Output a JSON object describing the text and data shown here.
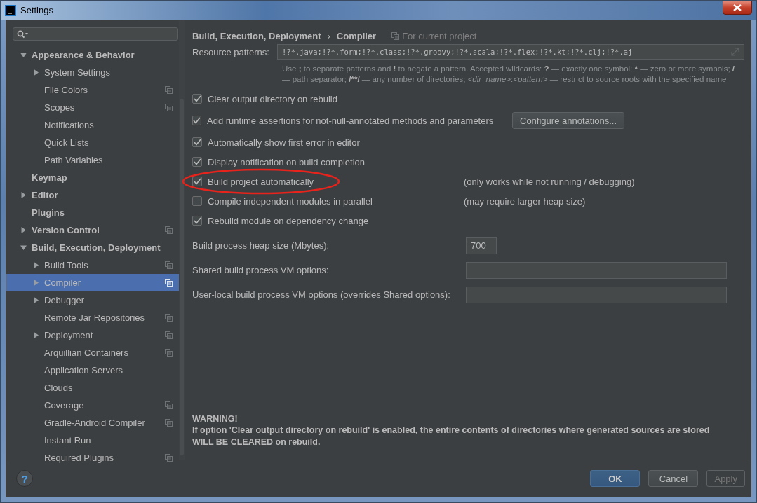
{
  "window": {
    "title": "Settings"
  },
  "sidebar": {
    "items": [
      {
        "label": "Appearance & Behavior",
        "expanded": true,
        "children": [
          {
            "label": "System Settings",
            "expanded": false
          },
          {
            "label": "File Colors",
            "project_level": true
          },
          {
            "label": "Scopes",
            "project_level": true
          },
          {
            "label": "Notifications"
          },
          {
            "label": "Quick Lists"
          },
          {
            "label": "Path Variables"
          }
        ]
      },
      {
        "label": "Keymap"
      },
      {
        "label": "Editor",
        "expanded": false
      },
      {
        "label": "Plugins"
      },
      {
        "label": "Version Control",
        "expanded": false,
        "project_level": true
      },
      {
        "label": "Build, Execution, Deployment",
        "expanded": true,
        "children": [
          {
            "label": "Build Tools",
            "expanded": false,
            "project_level": true
          },
          {
            "label": "Compiler",
            "expanded": false,
            "project_level": true,
            "selected": true
          },
          {
            "label": "Debugger",
            "expanded": false
          },
          {
            "label": "Remote Jar Repositories",
            "project_level": true
          },
          {
            "label": "Deployment",
            "expanded": false,
            "project_level": true
          },
          {
            "label": "Arquillian Containers",
            "project_level": true
          },
          {
            "label": "Application Servers"
          },
          {
            "label": "Clouds"
          },
          {
            "label": "Coverage",
            "project_level": true
          },
          {
            "label": "Gradle-Android Compiler",
            "project_level": true
          },
          {
            "label": "Instant Run"
          },
          {
            "label": "Required Plugins",
            "project_level": true
          }
        ]
      }
    ]
  },
  "breadcrumb": {
    "items": [
      "Build, Execution, Deployment",
      "Compiler"
    ],
    "separator": "›",
    "scope": "For current project"
  },
  "resource_patterns": {
    "label": "Resource patterns:",
    "value": "!?*.java;!?*.form;!?*.class;!?*.groovy;!?*.scala;!?*.flex;!?*.kt;!?*.clj;!?*.aj",
    "help": [
      {
        "text": "Use ",
        "kind": "text"
      },
      {
        "text": ";",
        "kind": "symbol"
      },
      {
        "text": " to separate patterns and ",
        "kind": "text"
      },
      {
        "text": "!",
        "kind": "symbol"
      },
      {
        "text": " to negate a pattern. Accepted wildcards: ",
        "kind": "text"
      },
      {
        "text": "?",
        "kind": "symbol"
      },
      {
        "text": " — exactly one symbol; ",
        "kind": "text"
      },
      {
        "text": "*",
        "kind": "symbol"
      },
      {
        "text": " — zero or more symbols; ",
        "kind": "text"
      },
      {
        "text": "/",
        "kind": "symbol"
      },
      {
        "text": " — path separator; ",
        "kind": "text"
      },
      {
        "text": "/**/",
        "kind": "symbol"
      },
      {
        "text": " — any number of directories; ",
        "kind": "text"
      },
      {
        "text": "<dir_name>",
        "kind": "placeholder"
      },
      {
        "text": ":",
        "kind": "text"
      },
      {
        "text": "<pattern>",
        "kind": "placeholder"
      },
      {
        "text": " — restrict to source roots with the specified name",
        "kind": "text"
      }
    ]
  },
  "options": [
    {
      "label": "Clear output directory on rebuild",
      "checked": true
    },
    {
      "label": "Add runtime assertions for not-null-annotated methods and parameters",
      "checked": true,
      "button": "Configure annotations..."
    },
    {
      "label": "Automatically show first error in editor",
      "checked": true
    },
    {
      "label": "Display notification on build completion",
      "checked": true
    },
    {
      "label": "Build project automatically",
      "checked": true,
      "note": "(only works while not running / debugging)",
      "highlighted": true
    },
    {
      "label": "Compile independent modules in parallel",
      "checked": false,
      "note": "(may require larger heap size)"
    },
    {
      "label": "Rebuild module on dependency change",
      "checked": true
    }
  ],
  "fields": [
    {
      "label": "Build process heap size (Mbytes):",
      "value": "700",
      "kind": "short"
    },
    {
      "label": "Shared build process VM options:",
      "kind": "wide"
    },
    {
      "label": "User-local build process VM options (overrides Shared options):",
      "kind": "wide"
    }
  ],
  "warning": {
    "title": "WARNING!",
    "lines": [
      "If option 'Clear output directory on rebuild' is enabled, the entire contents of directories where generated sources are stored",
      "WILL BE CLEARED on rebuild."
    ]
  },
  "footer": {
    "help": "?",
    "buttons": [
      {
        "label": "OK",
        "kind": "default",
        "disabled": false
      },
      {
        "label": "Cancel",
        "kind": "normal",
        "disabled": false
      },
      {
        "label": "Apply",
        "kind": "normal",
        "disabled": true
      }
    ]
  }
}
